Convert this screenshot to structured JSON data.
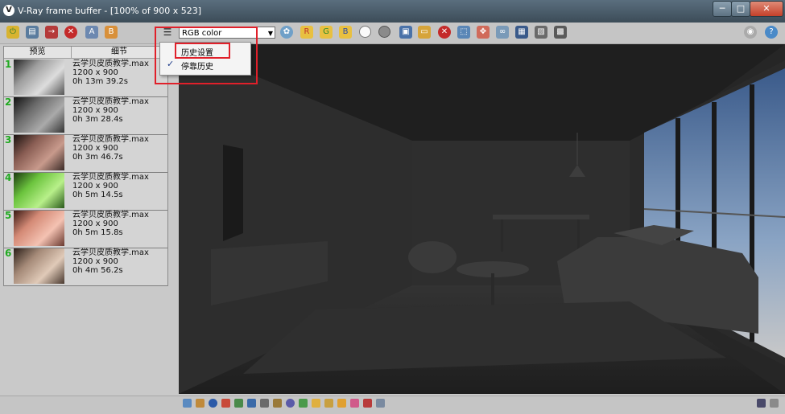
{
  "window": {
    "title": "V-Ray frame buffer - [100% of 900 x 523]",
    "app_icon": "vray-icon",
    "controls": [
      "minimize",
      "maximize",
      "close"
    ]
  },
  "toolbar": {
    "channel_select_value": "RGB color",
    "left_icons": [
      "power-icon",
      "save-icon",
      "load-icon",
      "clear-icon",
      "a-channel-icon",
      "b-channel-icon"
    ],
    "right_icons": [
      "list-icon",
      "color-picker-icon",
      "red-channel-icon",
      "green-channel-icon",
      "blue-channel-icon",
      "white-circle-icon",
      "gray-circle-icon",
      "save-image-icon",
      "folder-icon",
      "stop-icon",
      "region-icon",
      "track-mouse-icon",
      "link-icon",
      "lut-icon",
      "history-icon",
      "settings-icon"
    ]
  },
  "dropdown_menu": {
    "items": [
      {
        "label": "历史设置",
        "checked": false
      },
      {
        "label": "停靠历史",
        "checked": true
      }
    ]
  },
  "history_panel": {
    "columns": [
      "预览",
      "细节"
    ],
    "rows": [
      {
        "num": "1",
        "file": "云学贝皮质教学.max",
        "res": "1200 x 900",
        "time": "0h 13m 39.2s",
        "tint": "#9e9e9e"
      },
      {
        "num": "2",
        "file": "云学贝皮质教学.max",
        "res": "1200 x 900",
        "time": "0h 3m 28.4s",
        "tint": "#6a6a6a"
      },
      {
        "num": "3",
        "file": "云学贝皮质教学.max",
        "res": "1200 x 900",
        "time": "0h 3m 46.7s",
        "tint": "#8a5e54"
      },
      {
        "num": "4",
        "file": "云学贝皮质教学.max",
        "res": "1200 x 900",
        "time": "0h 5m 14.5s",
        "tint": "#6cc43e"
      },
      {
        "num": "5",
        "file": "云学贝皮质教学.max",
        "res": "1200 x 900",
        "time": "0h 5m 15.8s",
        "tint": "#d48a76"
      },
      {
        "num": "6",
        "file": "云学贝皮质教学.max",
        "res": "1200 x 900",
        "time": "0h 4m 56.2s",
        "tint": "#a58a78"
      }
    ]
  },
  "statusbar": {
    "icons": [
      "monitor-icon",
      "history-list-icon",
      "info-icon",
      "levels-icon",
      "curves-icon",
      "histogram-icon",
      "exposure-icon",
      "white-balance-icon",
      "hsl-icon",
      "color-balance-icon",
      "lut-icon",
      "ocio-icon",
      "icc-icon",
      "lens-effects-icon",
      "stamp-icon",
      "display-icon"
    ]
  }
}
